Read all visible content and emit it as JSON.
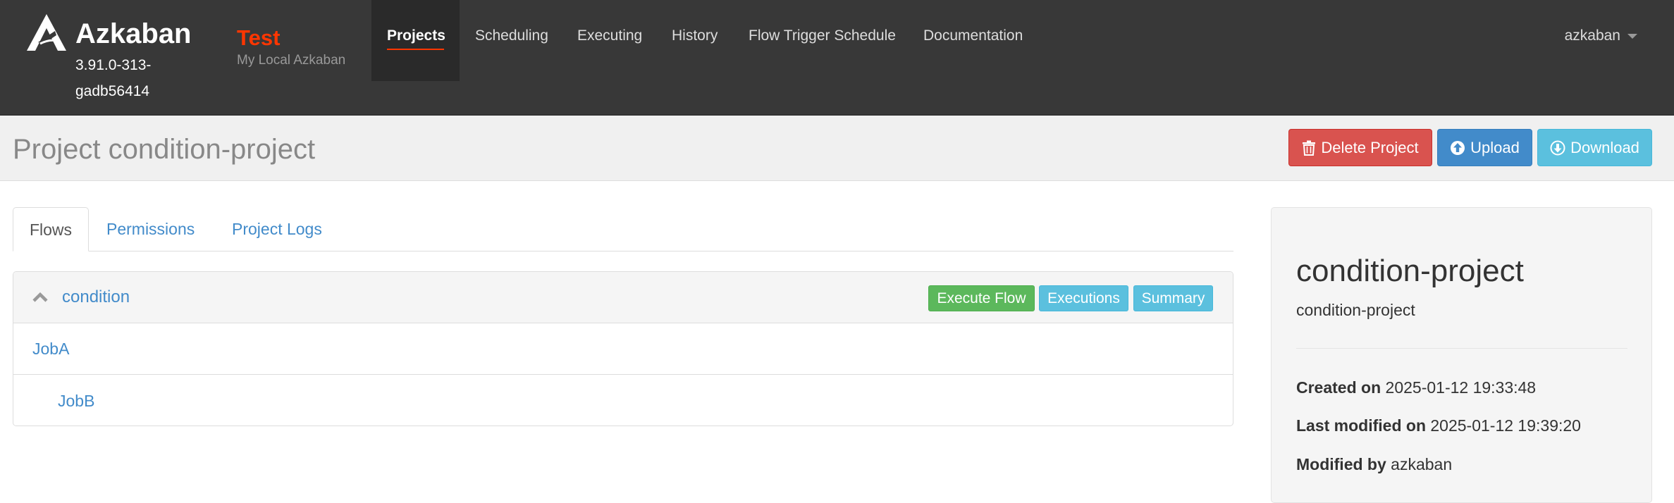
{
  "brand": {
    "name": "Azkaban",
    "version": "3.91.0-313-gadb56414",
    "logo_icon": "azkaban-logo-icon"
  },
  "environment": {
    "name": "Test",
    "description": "My Local Azkaban"
  },
  "nav": {
    "items": [
      {
        "label": "Projects",
        "active": true
      },
      {
        "label": "Scheduling"
      },
      {
        "label": "Executing"
      },
      {
        "label": "History"
      },
      {
        "label": "Flow Trigger Schedule"
      },
      {
        "label": "Documentation"
      }
    ],
    "user": "azkaban"
  },
  "header": {
    "title": "Project condition-project",
    "delete_label": "Delete Project",
    "upload_label": "Upload",
    "download_label": "Download"
  },
  "tabs": [
    {
      "label": "Flows",
      "active": true
    },
    {
      "label": "Permissions"
    },
    {
      "label": "Project Logs"
    }
  ],
  "flow": {
    "name": "condition",
    "execute_label": "Execute Flow",
    "executions_label": "Executions",
    "summary_label": "Summary",
    "jobs": [
      "JobA",
      "JobB"
    ]
  },
  "sidebar": {
    "title": "condition-project",
    "description": "condition-project",
    "created_label": "Created on",
    "created_value": "2025-01-12 19:33:48",
    "modified_label": "Last modified on",
    "modified_value": "2025-01-12 19:39:20",
    "modified_by_label": "Modified by",
    "modified_by_value": "azkaban"
  },
  "colors": {
    "navbar": "#383838",
    "accent": "#ff3601",
    "link": "#428bca",
    "danger": "#d9534f",
    "primary": "#428bca",
    "info": "#5bc0de",
    "success": "#5cb85c"
  }
}
